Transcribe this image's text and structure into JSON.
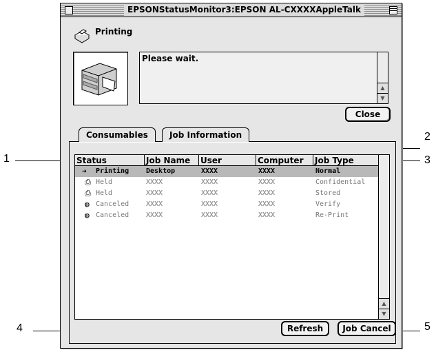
{
  "window": {
    "title": "EPSONStatusMonitor3:EPSON AL-CXXXXAppleTalk"
  },
  "status": {
    "title": "Printing",
    "icon": "printer-status-icon",
    "message": "Please wait."
  },
  "buttons": {
    "close": "Close",
    "refresh": "Refresh",
    "job_cancel": "Job Cancel"
  },
  "tabs": [
    {
      "label": "Consumables",
      "active": false
    },
    {
      "label": "Job Information",
      "active": true
    }
  ],
  "table": {
    "columns": [
      "Status",
      "Job Name",
      "User",
      "Computer",
      "Job Type"
    ],
    "rows": [
      {
        "status": "Printing",
        "icon": "arrow-printer-icon",
        "job_name": "Desktop",
        "user": "XXXX",
        "computer": "XXXX",
        "job_type": "Normal",
        "selected": true
      },
      {
        "status": "Held",
        "icon": "held-document-icon",
        "job_name": "XXXX",
        "user": "XXXX",
        "computer": "XXXX",
        "job_type": "Confidential",
        "selected": false
      },
      {
        "status": "Held",
        "icon": "held-document-icon",
        "job_name": "XXXX",
        "user": "XXXX",
        "computer": "XXXX",
        "job_type": "Stored",
        "selected": false
      },
      {
        "status": "Canceled",
        "icon": "canceled-icon",
        "job_name": "XXXX",
        "user": "XXXX",
        "computer": "XXXX",
        "job_type": "Verify",
        "selected": false
      },
      {
        "status": "Canceled",
        "icon": "canceled-icon",
        "job_name": "XXXX",
        "user": "XXXX",
        "computer": "XXXX",
        "job_type": "Re-Print",
        "selected": false
      }
    ]
  },
  "callouts": [
    "1",
    "2",
    "3",
    "4",
    "5"
  ]
}
